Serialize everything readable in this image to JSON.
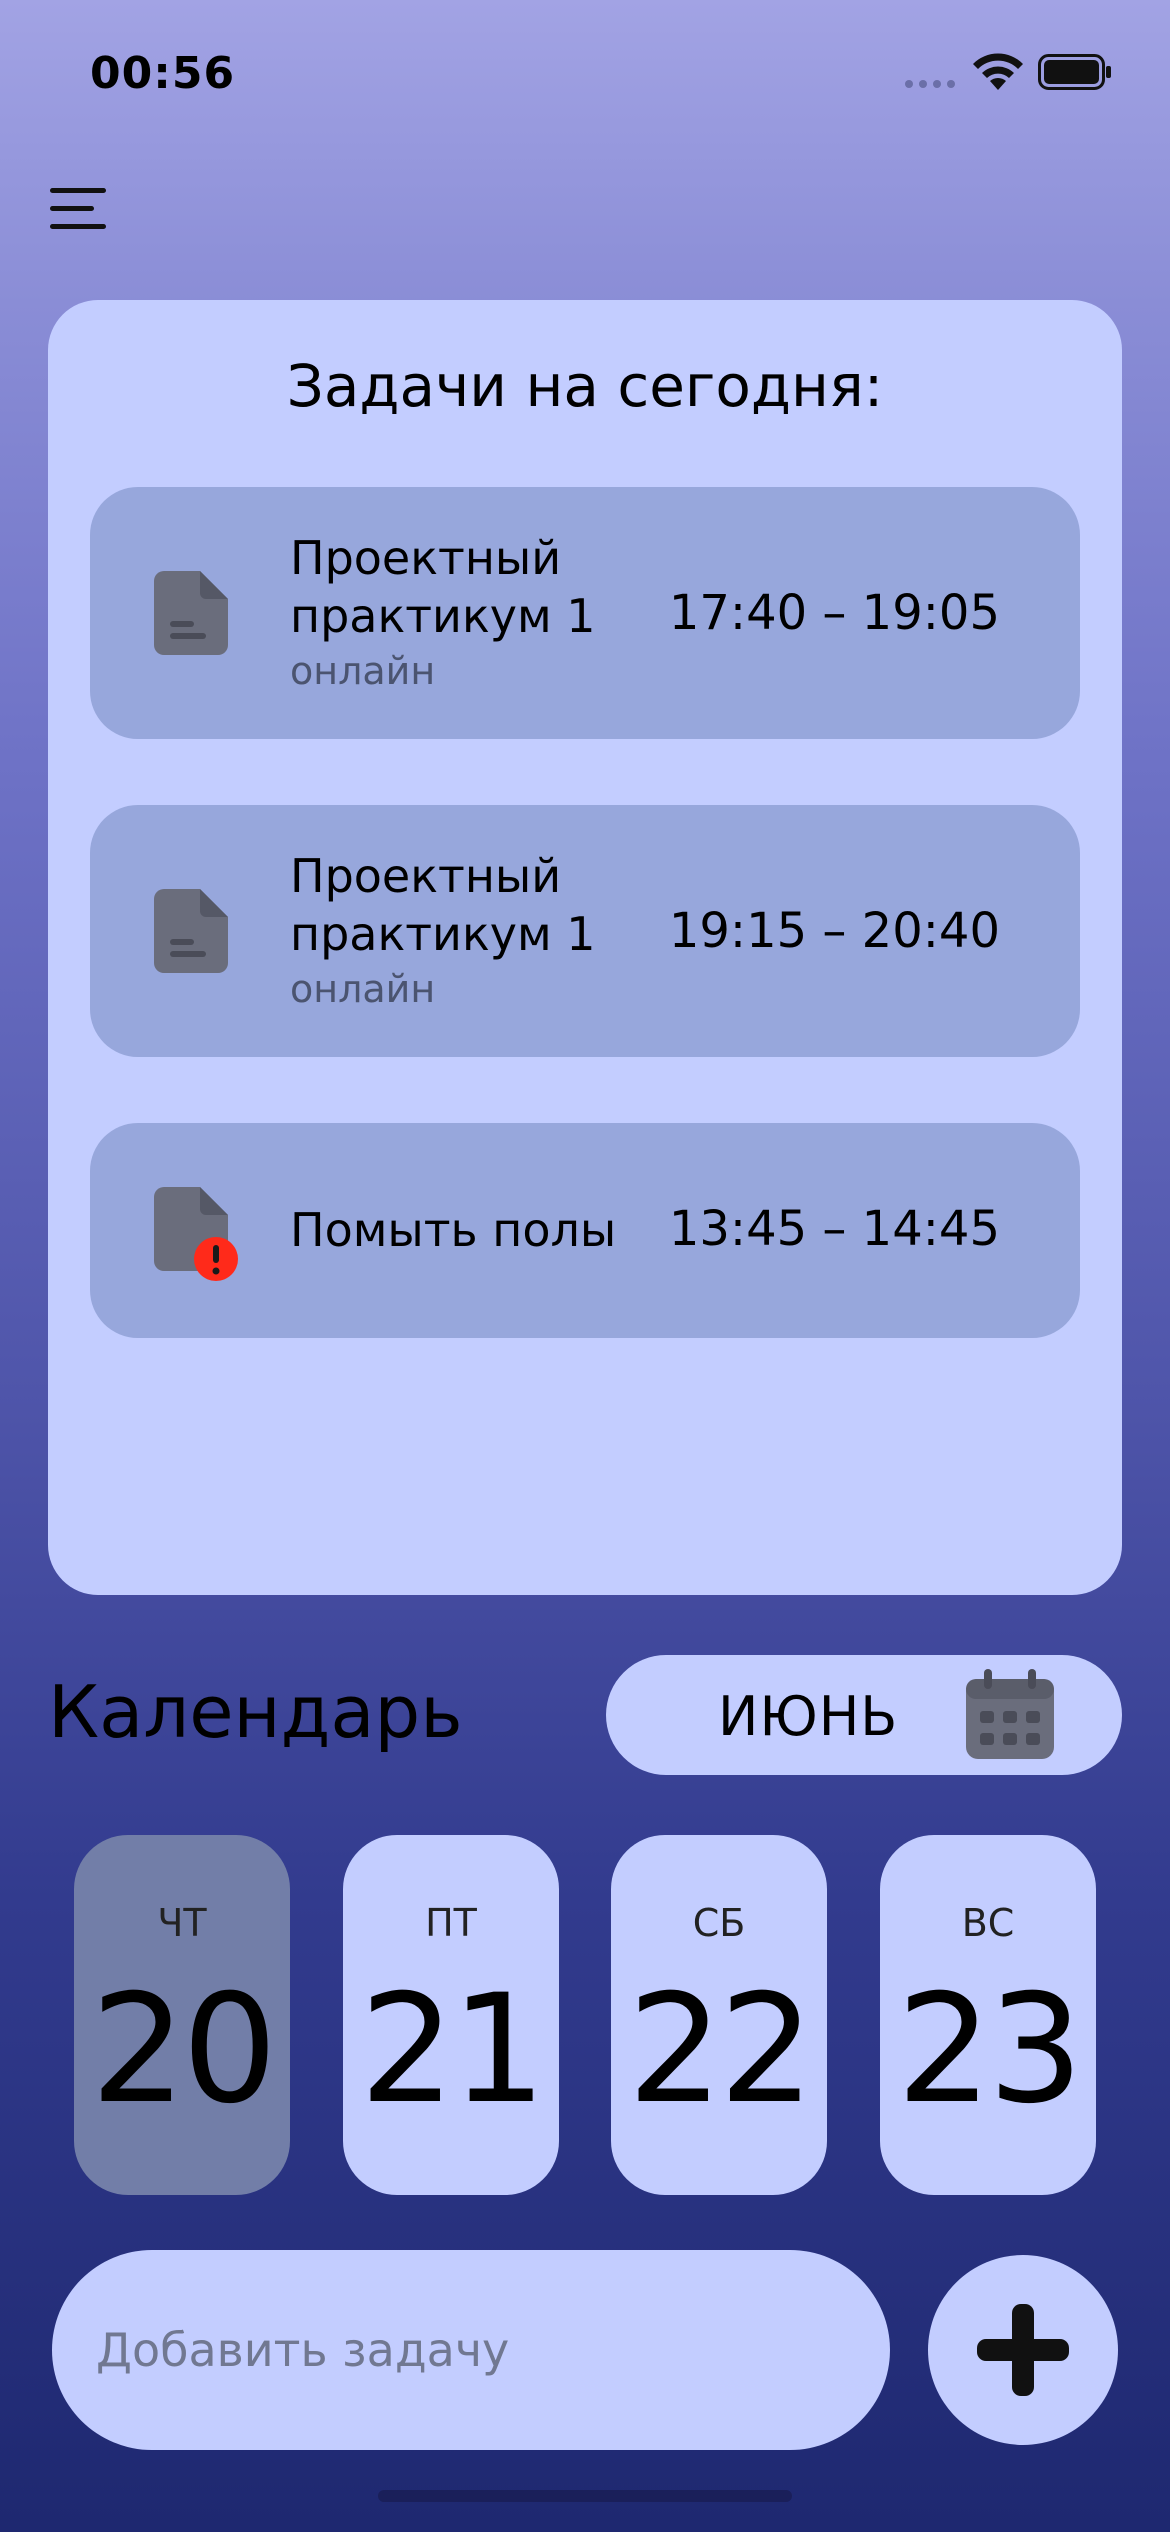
{
  "status_bar": {
    "time": "00:56"
  },
  "tasks_panel": {
    "title": "Задачи на сегодня:",
    "tasks": [
      {
        "name_line1": "Проектный",
        "name_line2": "практикум 1",
        "mode": "онлайн",
        "time": "17:40 – 19:05",
        "icon": "document-icon"
      },
      {
        "name_line1": "Проектный",
        "name_line2": "практикум 1",
        "mode": "онлайн",
        "time": "19:15 – 20:40",
        "icon": "document-icon"
      },
      {
        "name": "Помыть полы",
        "time": "13:45 – 14:45",
        "icon": "document-alert-icon",
        "alert_color": "#ff2a1a"
      }
    ]
  },
  "calendar": {
    "title": "Календарь",
    "month": "ИЮНЬ",
    "days": [
      {
        "dow": "ЧТ",
        "num": "20",
        "selected": true
      },
      {
        "dow": "ПТ",
        "num": "21",
        "selected": false
      },
      {
        "dow": "СБ",
        "num": "22",
        "selected": false
      },
      {
        "dow": "ВС",
        "num": "23",
        "selected": false
      }
    ]
  },
  "add_task": {
    "placeholder": "Добавить задачу"
  },
  "colors": {
    "card": "#c3cdff",
    "task": "#97a7dc",
    "selected_day": "#727ea8",
    "icon": "#6a6d7c"
  }
}
